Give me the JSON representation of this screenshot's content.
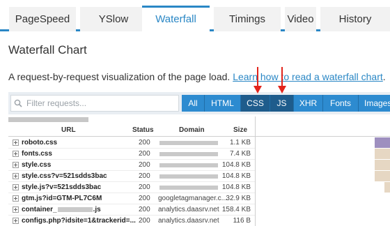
{
  "tabs": [
    {
      "label": "PageSpeed",
      "active": false
    },
    {
      "label": "YSlow",
      "active": false
    },
    {
      "label": "Waterfall",
      "active": true
    },
    {
      "label": "Timings",
      "active": false
    },
    {
      "label": "Video",
      "active": false
    },
    {
      "label": "History",
      "active": false
    }
  ],
  "heading": "Waterfall Chart",
  "description": {
    "text": "A request-by-request visualization of the page load. ",
    "link": "Learn how to read a waterfall chart",
    "suffix": "."
  },
  "filter": {
    "placeholder": "Filter requests...",
    "buttons": [
      {
        "label": "All",
        "selected": false
      },
      {
        "label": "HTML",
        "selected": false
      },
      {
        "label": "CSS",
        "selected": true
      },
      {
        "label": "JS",
        "selected": true
      },
      {
        "label": "XHR",
        "selected": false
      },
      {
        "label": "Fonts",
        "selected": false
      },
      {
        "label": "Images",
        "selected": false
      }
    ]
  },
  "table": {
    "headers": {
      "url": "URL",
      "status": "Status",
      "domain": "Domain",
      "size": "Size"
    },
    "rows": [
      {
        "url": "roboto.css",
        "status": "200",
        "domain": "",
        "size": "1.1 KB",
        "bar_color": "#9e8fbf"
      },
      {
        "url": "fonts.css",
        "status": "200",
        "domain": "",
        "size": "7.4 KB",
        "bar_color": "#e6d7c3"
      },
      {
        "url": "style.css",
        "status": "200",
        "domain": "",
        "size": "104.8 KB",
        "bar_color": "#e6d7c3"
      },
      {
        "url": "style.css?v=521sdds3bac",
        "status": "200",
        "domain": "",
        "size": "104.8 KB",
        "bar_color": "#e6d7c3"
      },
      {
        "url": "style.js?v=521sdds3bac",
        "status": "200",
        "domain": "",
        "size": "104.8 KB",
        "bar_color": "#e6d7c3"
      },
      {
        "url": "gtm.js?id=GTM-PL7C6M",
        "status": "200",
        "domain": "googletagmanager.c...",
        "size": "32.9 KB",
        "bar_color": ""
      },
      {
        "url_prefix": "container_",
        "url_suffix": ".js",
        "status": "200",
        "domain": "analytics.daasrv.net",
        "size": "158.4 KB",
        "bar_color": ""
      },
      {
        "url": "configs.php?idsite=1&trackerid=...",
        "status": "200",
        "domain": "analytics.daasrv.net",
        "size": "116 B",
        "bar_color": ""
      }
    ]
  },
  "colors": {
    "accent": "#2a87c5",
    "button": "#2d8bd0",
    "button_selected": "#1e5c8c",
    "arrow": "#e2241b"
  },
  "icons": [
    "search-icon",
    "expand-icon",
    "down-arrow-icon"
  ]
}
